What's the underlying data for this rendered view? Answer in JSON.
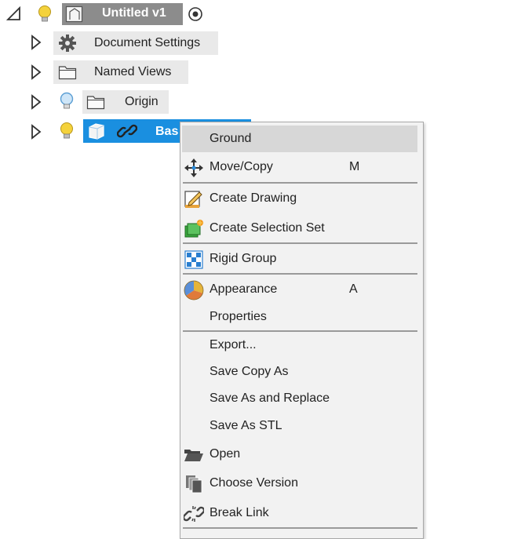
{
  "browser": {
    "root": {
      "title": "Untitled v1"
    },
    "items": [
      {
        "label": "Document Settings"
      },
      {
        "label": "Named Views"
      },
      {
        "label": "Origin"
      },
      {
        "label": "Bas"
      }
    ]
  },
  "context_menu": {
    "items": [
      {
        "label": "Ground",
        "shortcut": "",
        "icon": ""
      },
      {
        "label": "Move/Copy",
        "shortcut": "M",
        "icon": "move-icon"
      },
      {
        "label": "Create Drawing",
        "shortcut": "",
        "icon": "create-drawing-icon"
      },
      {
        "label": "Create Selection Set",
        "shortcut": "",
        "icon": "selection-set-icon"
      },
      {
        "label": "Rigid Group",
        "shortcut": "",
        "icon": "rigid-group-icon"
      },
      {
        "label": "Appearance",
        "shortcut": "A",
        "icon": "appearance-icon"
      },
      {
        "label": "Properties",
        "shortcut": "",
        "icon": ""
      },
      {
        "label": "Export...",
        "shortcut": "",
        "icon": ""
      },
      {
        "label": "Save Copy As",
        "shortcut": "",
        "icon": ""
      },
      {
        "label": "Save As and Replace",
        "shortcut": "",
        "icon": ""
      },
      {
        "label": "Save As STL",
        "shortcut": "",
        "icon": ""
      },
      {
        "label": "Open",
        "shortcut": "",
        "icon": "open-folder-icon"
      },
      {
        "label": "Choose Version",
        "shortcut": "",
        "icon": "choose-version-icon"
      },
      {
        "label": "Break Link",
        "shortcut": "",
        "icon": "break-link-icon"
      }
    ]
  },
  "colors": {
    "selection": "#1a8fe0",
    "bulb_on": "#f4d23c",
    "bulb_off": "#8cc4f0",
    "menu_hover": "#d7d7d7"
  }
}
